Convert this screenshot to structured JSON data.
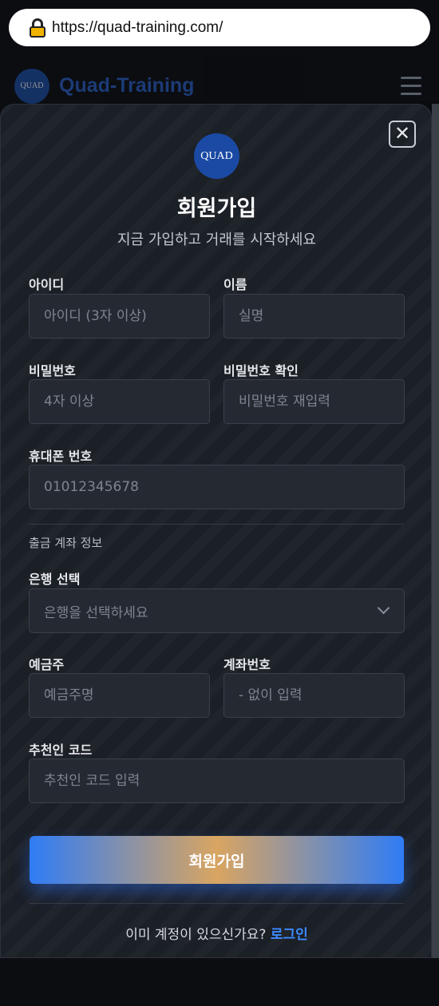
{
  "browser": {
    "url": "https://quad-training.com/"
  },
  "site": {
    "logo_text": "QUAD",
    "title": "Quad-Training"
  },
  "modal": {
    "close_symbol": "✕",
    "logo_text": "QUAD",
    "title": "회원가입",
    "subtitle": "지금 가입하고 거래를 시작하세요",
    "fields": {
      "username": {
        "label": "아이디",
        "placeholder": "아이디 (3자 이상)"
      },
      "name": {
        "label": "이름",
        "placeholder": "실명"
      },
      "password": {
        "label": "비밀번호",
        "placeholder": "4자 이상"
      },
      "password_confirm": {
        "label": "비밀번호 확인",
        "placeholder": "비밀번호 재입력"
      },
      "phone": {
        "label": "휴대폰 번호",
        "placeholder": "01012345678"
      },
      "bank": {
        "label": "은행 선택",
        "placeholder": "은행을 선택하세요"
      },
      "holder": {
        "label": "예금주",
        "placeholder": "예금주명"
      },
      "account": {
        "label": "계좌번호",
        "placeholder": "- 없이 입력"
      },
      "referral": {
        "label": "추천인 코드",
        "placeholder": "추천인 코드 입력"
      }
    },
    "section_account": "출금 계좌 정보",
    "submit_label": "회원가입",
    "login_prompt": "이미 계정이 있으신가요?",
    "login_link": "로그인"
  },
  "colors": {
    "accent": "#3d8bff",
    "background": "#1b1f26",
    "logo": "#1a4aa3"
  },
  "icons": [
    "lock-icon",
    "hamburger-menu-icon",
    "close-icon",
    "chevron-down-icon"
  ]
}
